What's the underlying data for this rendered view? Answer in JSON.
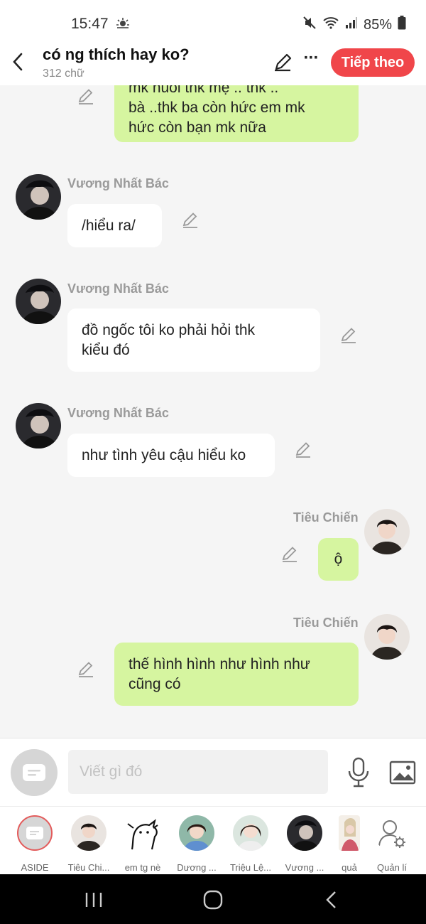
{
  "status_bar": {
    "time": "15:47",
    "battery": "85%",
    "icons": [
      "weather-icon",
      "mute-icon",
      "wifi-icon",
      "signal-icon",
      "battery-icon"
    ]
  },
  "header": {
    "title": "có ng thích hay ko?",
    "word_count": "312 chữ",
    "next_label": "Tiếp theo",
    "more_label": "···"
  },
  "colors": {
    "accent": "#f0464a",
    "right_bubble": "#d6f5a0",
    "left_bubble": "#ffffff",
    "background": "#f5f5f5"
  },
  "messages": [
    {
      "side": "right",
      "sender": "",
      "text": "mk nuôi thk mẹ .. thk ..\nbà ..thk ba còn hức em mk\nhức còn bạn mk nữa"
    },
    {
      "side": "left",
      "sender": "Vương Nhất Bác",
      "text": "/hiểu ra/"
    },
    {
      "side": "left",
      "sender": "Vương Nhất Bác",
      "text": "đồ ngốc tôi ko phải hỏi thk\nkiểu đó"
    },
    {
      "side": "left",
      "sender": "Vương Nhất Bác",
      "text": "như tình yêu cậu hiểu ko"
    },
    {
      "side": "right",
      "sender": "Tiêu Chiến",
      "text": "ộ"
    },
    {
      "side": "right",
      "sender": "Tiêu Chiến",
      "text": "thế hình hình như hình như\ncũng có"
    }
  ],
  "input": {
    "placeholder": "Viết gì đó"
  },
  "characters": [
    {
      "name": "ASIDE"
    },
    {
      "name": "Tiêu Chi..."
    },
    {
      "name": "em tg nè"
    },
    {
      "name": "Dương ..."
    },
    {
      "name": "Triệu Lệ..."
    },
    {
      "name": "Vương ..."
    },
    {
      "name": "quả"
    },
    {
      "name": "Quản lí"
    }
  ]
}
